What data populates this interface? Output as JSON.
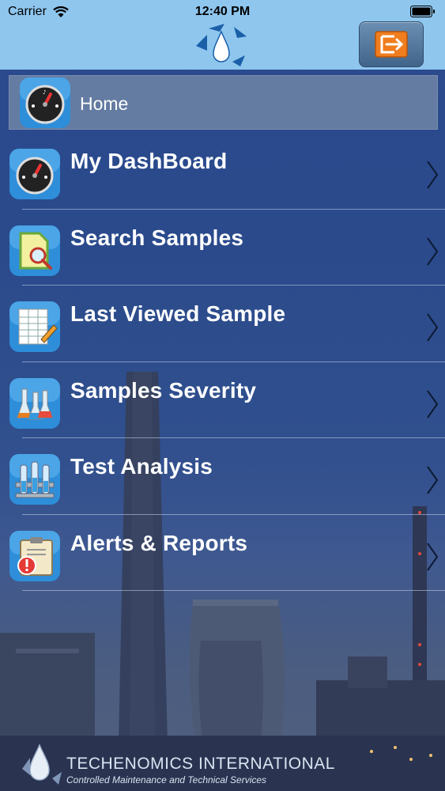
{
  "status_bar": {
    "carrier": "Carrier",
    "time": "12:40 PM"
  },
  "header": {
    "logo_icon": "water-drop-logo-icon",
    "exit_icon": "exit-icon"
  },
  "home": {
    "label": "Home",
    "icon": "gauge-icon"
  },
  "menu": [
    {
      "label": "My DashBoard",
      "icon": "gauge-icon"
    },
    {
      "label": "Search Samples",
      "icon": "document-search-icon"
    },
    {
      "label": "Last Viewed Sample",
      "icon": "spreadsheet-pencil-icon"
    },
    {
      "label": "Samples Severity",
      "icon": "flasks-icon"
    },
    {
      "label": "Test Analysis",
      "icon": "test-tubes-rack-icon"
    },
    {
      "label": "Alerts & Reports",
      "icon": "clipboard-alert-icon"
    }
  ],
  "footer": {
    "company": "TECHENOMICS INTERNATIONAL",
    "tagline": "Controlled Maintenance and Technical Services"
  },
  "colors": {
    "header_bg": "#8ec6ee",
    "accent_orange": "#f07d1e",
    "background": "#2b4b8e"
  }
}
